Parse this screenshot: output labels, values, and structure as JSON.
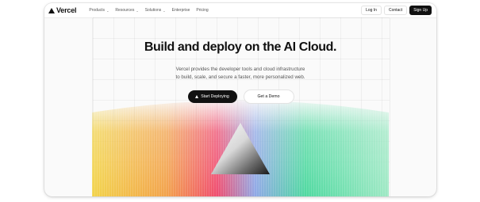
{
  "nav": {
    "logo_text": "Vercel",
    "menu": [
      {
        "label": "Products",
        "dropdown": true
      },
      {
        "label": "Resources",
        "dropdown": true
      },
      {
        "label": "Solutions",
        "dropdown": true
      },
      {
        "label": "Enterprise",
        "dropdown": false
      },
      {
        "label": "Pricing",
        "dropdown": false
      }
    ],
    "login": "Log In",
    "contact": "Contact",
    "signup": "Sign Up"
  },
  "hero": {
    "headline": "Build and deploy on the AI Cloud.",
    "subline_1": "Vercel provides the developer tools and cloud infrastructure",
    "subline_2": "to build, scale, and secure a faster, more personalized web.",
    "primary_cta": "Start Deploying",
    "secondary_cta": "Get a Demo"
  },
  "icons": {
    "logo": "vercel-triangle-icon",
    "chevron": "chevron-down-icon",
    "cta": "triangle-icon"
  },
  "colors": {
    "text": "#111111",
    "muted": "#555555",
    "background": "#fafafa",
    "button_dark": "#111111",
    "gradient": [
      "#f2b84a",
      "#f04c6e",
      "#7ab7f0",
      "#4fd9a0"
    ]
  }
}
